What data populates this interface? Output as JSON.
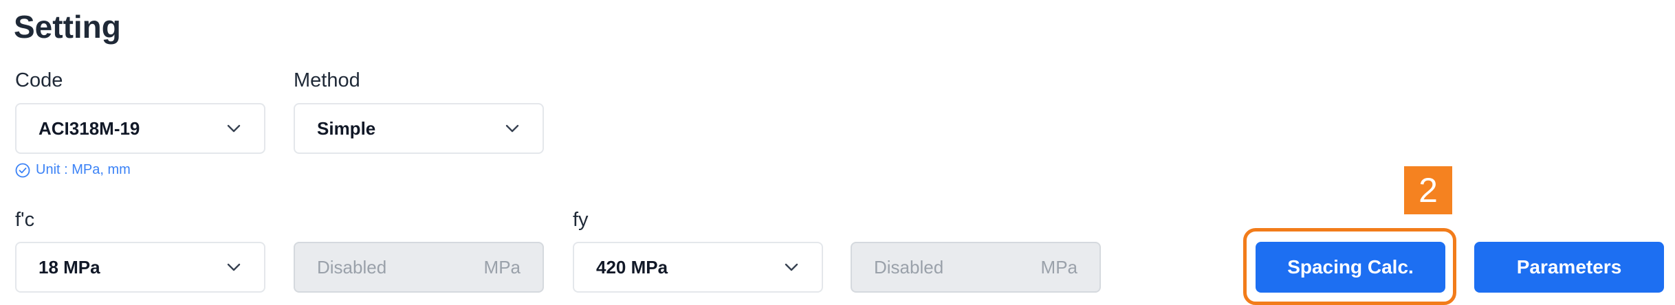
{
  "page": {
    "title": "Setting"
  },
  "fields": {
    "code": {
      "label": "Code",
      "value": "ACI318M-19"
    },
    "method": {
      "label": "Method",
      "value": "Simple"
    },
    "unit_note": "Unit : MPa, mm",
    "fc": {
      "label": "f'c",
      "value": "18 MPa",
      "disabled_value": "Disabled",
      "disabled_unit": "MPa"
    },
    "fy": {
      "label": "fy",
      "value": "420 MPa",
      "disabled_value": "Disabled",
      "disabled_unit": "MPa"
    }
  },
  "buttons": {
    "spacing_calc": "Spacing Calc.",
    "parameters": "Parameters"
  },
  "annotation": {
    "step_number": "2",
    "color": "#f58220"
  },
  "colors": {
    "primary": "#1d6ff2",
    "unit_note": "#3b82f6",
    "disabled_bg": "#e9ebee"
  }
}
